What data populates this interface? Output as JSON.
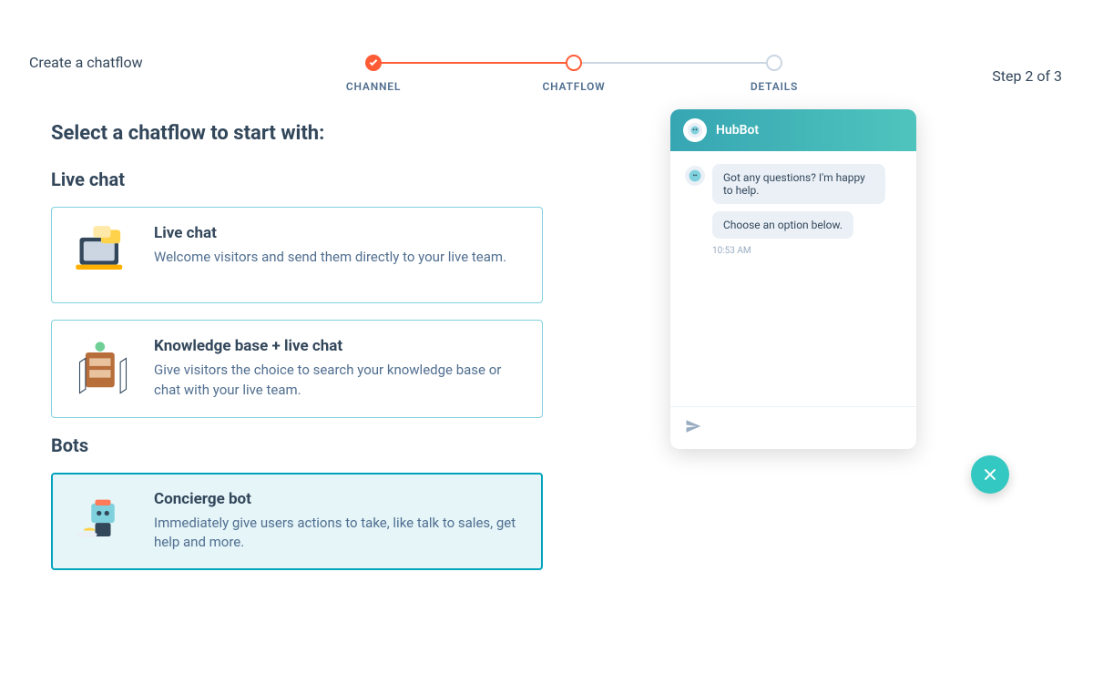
{
  "header": {
    "title": "Create a chatflow",
    "step_counter": "Step 2 of 3"
  },
  "stepper": {
    "steps": [
      {
        "label": "CHANNEL",
        "state": "done"
      },
      {
        "label": "CHATFLOW",
        "state": "current"
      },
      {
        "label": "DETAILS",
        "state": "pending"
      }
    ]
  },
  "page": {
    "title": "Select a chatflow to start with:"
  },
  "sections": {
    "live_chat_heading": "Live chat",
    "bots_heading": "Bots"
  },
  "cards": {
    "live_chat": {
      "title": "Live chat",
      "desc": "Welcome visitors and send them directly to your live team.",
      "selected": false
    },
    "kb_live_chat": {
      "title": "Knowledge base + live chat",
      "desc": "Give visitors the choice to search your knowledge base or chat with your live team.",
      "selected": false
    },
    "concierge_bot": {
      "title": "Concierge bot",
      "desc": "Immediately give users actions to take, like talk to sales, get help and more.",
      "selected": true
    }
  },
  "chat_preview": {
    "bot_name": "HubBot",
    "messages": [
      "Got any questions? I'm happy to help.",
      "Choose an option below."
    ],
    "timestamp": "10:53 AM"
  },
  "colors": {
    "accent_orange": "#ff5c35",
    "accent_teal": "#00a4bd",
    "teal_gradient_start": "#36a6b3",
    "teal_gradient_end": "#4fc4bd"
  }
}
